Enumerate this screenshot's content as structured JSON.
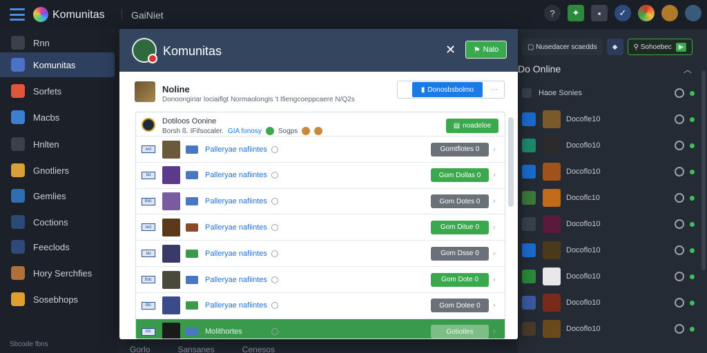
{
  "topbar": {
    "app_title": "Komunitas",
    "section": "GaiNiet",
    "icons": [
      "help-icon",
      "puzzle-icon",
      "bell-icon",
      "shield-icon",
      "chrome-icon",
      "avatar-icon",
      "profile-icon"
    ]
  },
  "sidebar": {
    "items": [
      {
        "label": "Rnn",
        "icon": "home-icon",
        "color": "#3a414c"
      },
      {
        "label": "Komunitas",
        "icon": "community-icon",
        "color": "#4a72c8",
        "active": true
      },
      {
        "label": "Sorfets",
        "icon": "store-icon",
        "color": "#e0563a"
      },
      {
        "label": "Macbs",
        "icon": "map-icon",
        "color": "#3b7fd0"
      },
      {
        "label": "Hnlten",
        "icon": "hint-icon",
        "color": "#3a414c"
      },
      {
        "label": "Gnotliers",
        "icon": "games-icon",
        "color": "#d9a03a"
      },
      {
        "label": "Gemlies",
        "icon": "library-icon",
        "color": "#2f6fb0"
      },
      {
        "label": "Coctions",
        "icon": "collection-icon",
        "color": "#2a4a78"
      },
      {
        "label": "Feeclods",
        "icon": "feed-icon",
        "color": "#2e4a7a"
      },
      {
        "label": "Hory Serchfies",
        "icon": "history-icon",
        "color": "#b0703a"
      },
      {
        "label": "Sosebhops",
        "icon": "shop-icon",
        "color": "#e0a030"
      }
    ],
    "footer": "Sbcode fbns"
  },
  "bottom_tabs": [
    "Gorlo",
    "Sansanes",
    "Cenesos"
  ],
  "online_panel": {
    "toolbar_label": "Nusedacer scaedds",
    "search_label": "Sohoebec",
    "title": "Do Online",
    "rows": [
      {
        "name": "Haoe Sonies",
        "sq": "#3a414c",
        "av": "#4a3a22"
      },
      {
        "name": "Docofle10",
        "sq": "#1a6bd0",
        "av": "#7a5a2a"
      },
      {
        "name": "Docoflo10",
        "sq": "#1e8a6a",
        "av": "#2a2a2a"
      },
      {
        "name": "Docoflo10",
        "sq": "#1a6bd0",
        "av": "#a0521a"
      },
      {
        "name": "Docoflc10",
        "sq": "#3a7a3a",
        "av": "#c06a1a"
      },
      {
        "name": "Docoflo10",
        "sq": "#3a414c",
        "av": "#5a1a3a"
      },
      {
        "name": "Docoflo10",
        "sq": "#1a6bd0",
        "av": "#4a3a1a"
      },
      {
        "name": "Docoflo10",
        "sq": "#2a8a3a",
        "av": "#e8e8e8"
      },
      {
        "name": "Docoflo10",
        "sq": "#3a5aa0",
        "av": "#7a2a1a"
      },
      {
        "name": "Docoflo10",
        "sq": "#4a3a2a",
        "av": "#6a4a1a"
      }
    ]
  },
  "modal": {
    "title": "Komunitas",
    "close_glyph": "✕",
    "head_button": "Nalo",
    "profile": {
      "name": "Nolinе",
      "description": "Donoongiriar lociaiflgt Normaolongis 't Ifiengcoeppcaere N/Q2s"
    },
    "primary_button": "Donosbsbolmo",
    "more_button": "···",
    "list_header": {
      "title": "Dotiloos Oonine",
      "sub_prefix": "Borsh ß. IFifsocaler.",
      "sub_highlight": "GIA fonosy",
      "sub_suffix": "Sogps",
      "button": "noadeloe"
    },
    "rows": [
      {
        "tag": "wcl",
        "av": "#6a5a3a",
        "g": "#4a78c0",
        "name": "Palleryae nafiintes",
        "btn": "Gomtflotes 0",
        "style": "gray"
      },
      {
        "tag": "laɪ",
        "av": "#5a3a8a",
        "g": "#4a78c0",
        "name": "Palleryae nafiintes",
        "btn": "Gom Dollas 0",
        "style": "green"
      },
      {
        "tag": "Bdc",
        "av": "#7a5aa0",
        "g": "#4a78c0",
        "name": "Palleryae nafiintes",
        "btn": "Gom Dotes 0",
        "style": "gray"
      },
      {
        "tag": "wcl",
        "av": "#5a3a1a",
        "g": "#8a4a2a",
        "name": "Palleryae nafiintes",
        "btn": "Gom Ditue 0",
        "style": "green"
      },
      {
        "tag": "laɪ",
        "av": "#3a3a6a",
        "g": "#3a9a4a",
        "name": "Palleryae nafiintes",
        "btn": "Gom Dsse 0",
        "style": "gray"
      },
      {
        "tag": "Bdc",
        "av": "#4a4a3a",
        "g": "#4a78c0",
        "name": "Palleryae nafiintes",
        "btn": "Gom Dote 0",
        "style": "green"
      },
      {
        "tag": "Blc",
        "av": "#3a4a8a",
        "g": "#3a9a4a",
        "name": "Palleryae nafiintes",
        "btn": "Gom Dotee 0",
        "style": "gray"
      },
      {
        "tag": "blc",
        "av": "#1a1a1a",
        "g": "#4a78c0",
        "name": "Molithortes",
        "btn": "Gotiotles",
        "style": "ghost",
        "selected": true
      }
    ]
  }
}
